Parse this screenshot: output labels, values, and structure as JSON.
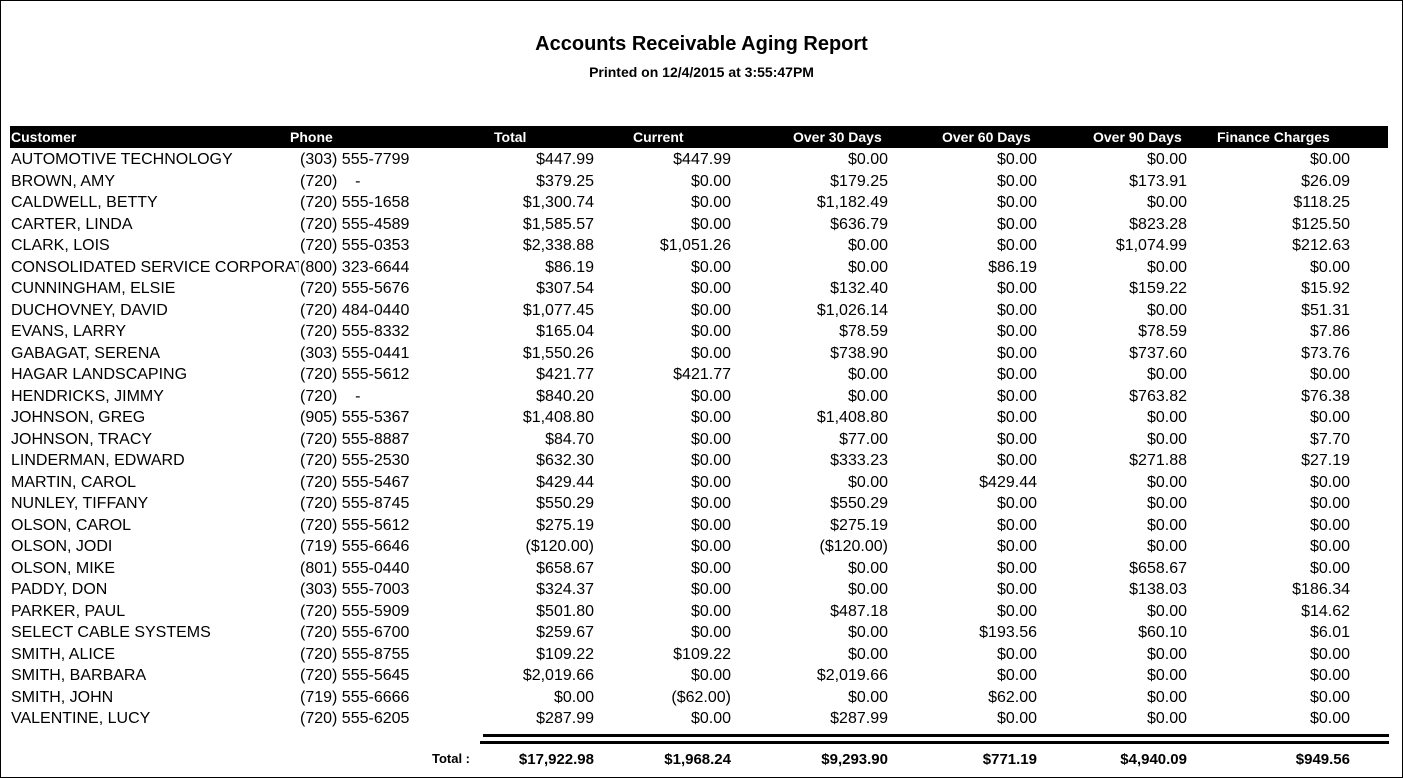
{
  "report": {
    "title": "Accounts Receivable Aging Report",
    "printed": "Printed on 12/4/2015 at  3:55:47PM"
  },
  "columns": {
    "customer": "Customer",
    "phone": "Phone",
    "total": "Total",
    "current": "Current",
    "over30": "Over 30 Days",
    "over60": "Over 60 Days",
    "over90": "Over 90 Days",
    "finance": "Finance Charges"
  },
  "rows": [
    {
      "customer": "AUTOMOTIVE TECHNOLOGY",
      "phone": "(303) 555-7799",
      "total": "$447.99",
      "current": "$447.99",
      "over30": "$0.00",
      "over60": "$0.00",
      "over90": "$0.00",
      "finance": "$0.00"
    },
    {
      "customer": "BROWN, AMY",
      "phone": "(720)    -",
      "total": "$379.25",
      "current": "$0.00",
      "over30": "$179.25",
      "over60": "$0.00",
      "over90": "$173.91",
      "finance": "$26.09"
    },
    {
      "customer": "CALDWELL, BETTY",
      "phone": "(720) 555-1658",
      "total": "$1,300.74",
      "current": "$0.00",
      "over30": "$1,182.49",
      "over60": "$0.00",
      "over90": "$0.00",
      "finance": "$118.25"
    },
    {
      "customer": "CARTER, LINDA",
      "phone": "(720) 555-4589",
      "total": "$1,585.57",
      "current": "$0.00",
      "over30": "$636.79",
      "over60": "$0.00",
      "over90": "$823.28",
      "finance": "$125.50"
    },
    {
      "customer": "CLARK, LOIS",
      "phone": "(720) 555-0353",
      "total": "$2,338.88",
      "current": "$1,051.26",
      "over30": "$0.00",
      "over60": "$0.00",
      "over90": "$1,074.99",
      "finance": "$212.63"
    },
    {
      "customer": "CONSOLIDATED SERVICE CORPORATION",
      "phone": "(800) 323-6644",
      "total": "$86.19",
      "current": "$0.00",
      "over30": "$0.00",
      "over60": "$86.19",
      "over90": "$0.00",
      "finance": "$0.00"
    },
    {
      "customer": "CUNNINGHAM, ELSIE",
      "phone": "(720) 555-5676",
      "total": "$307.54",
      "current": "$0.00",
      "over30": "$132.40",
      "over60": "$0.00",
      "over90": "$159.22",
      "finance": "$15.92"
    },
    {
      "customer": "DUCHOVNEY, DAVID",
      "phone": "(720) 484-0440",
      "total": "$1,077.45",
      "current": "$0.00",
      "over30": "$1,026.14",
      "over60": "$0.00",
      "over90": "$0.00",
      "finance": "$51.31"
    },
    {
      "customer": "EVANS, LARRY",
      "phone": "(720) 555-8332",
      "total": "$165.04",
      "current": "$0.00",
      "over30": "$78.59",
      "over60": "$0.00",
      "over90": "$78.59",
      "finance": "$7.86"
    },
    {
      "customer": "GABAGAT, SERENA",
      "phone": "(303) 555-0441",
      "total": "$1,550.26",
      "current": "$0.00",
      "over30": "$738.90",
      "over60": "$0.00",
      "over90": "$737.60",
      "finance": "$73.76"
    },
    {
      "customer": "HAGAR LANDSCAPING",
      "phone": "(720) 555-5612",
      "total": "$421.77",
      "current": "$421.77",
      "over30": "$0.00",
      "over60": "$0.00",
      "over90": "$0.00",
      "finance": "$0.00"
    },
    {
      "customer": "HENDRICKS, JIMMY",
      "phone": "(720)    -",
      "total": "$840.20",
      "current": "$0.00",
      "over30": "$0.00",
      "over60": "$0.00",
      "over90": "$763.82",
      "finance": "$76.38"
    },
    {
      "customer": "JOHNSON, GREG",
      "phone": "(905) 555-5367",
      "total": "$1,408.80",
      "current": "$0.00",
      "over30": "$1,408.80",
      "over60": "$0.00",
      "over90": "$0.00",
      "finance": "$0.00"
    },
    {
      "customer": "JOHNSON, TRACY",
      "phone": "(720) 555-8887",
      "total": "$84.70",
      "current": "$0.00",
      "over30": "$77.00",
      "over60": "$0.00",
      "over90": "$0.00",
      "finance": "$7.70"
    },
    {
      "customer": "LINDERMAN, EDWARD",
      "phone": "(720) 555-2530",
      "total": "$632.30",
      "current": "$0.00",
      "over30": "$333.23",
      "over60": "$0.00",
      "over90": "$271.88",
      "finance": "$27.19"
    },
    {
      "customer": "MARTIN, CAROL",
      "phone": "(720) 555-5467",
      "total": "$429.44",
      "current": "$0.00",
      "over30": "$0.00",
      "over60": "$429.44",
      "over90": "$0.00",
      "finance": "$0.00"
    },
    {
      "customer": "NUNLEY, TIFFANY",
      "phone": "(720) 555-8745",
      "total": "$550.29",
      "current": "$0.00",
      "over30": "$550.29",
      "over60": "$0.00",
      "over90": "$0.00",
      "finance": "$0.00"
    },
    {
      "customer": "OLSON, CAROL",
      "phone": "(720) 555-5612",
      "total": "$275.19",
      "current": "$0.00",
      "over30": "$275.19",
      "over60": "$0.00",
      "over90": "$0.00",
      "finance": "$0.00"
    },
    {
      "customer": "OLSON, JODI",
      "phone": "(719) 555-6646",
      "total": "($120.00)",
      "current": "$0.00",
      "over30": "($120.00)",
      "over60": "$0.00",
      "over90": "$0.00",
      "finance": "$0.00"
    },
    {
      "customer": "OLSON, MIKE",
      "phone": "(801) 555-0440",
      "total": "$658.67",
      "current": "$0.00",
      "over30": "$0.00",
      "over60": "$0.00",
      "over90": "$658.67",
      "finance": "$0.00"
    },
    {
      "customer": "PADDY, DON",
      "phone": "(303) 555-7003",
      "total": "$324.37",
      "current": "$0.00",
      "over30": "$0.00",
      "over60": "$0.00",
      "over90": "$138.03",
      "finance": "$186.34"
    },
    {
      "customer": "PARKER, PAUL",
      "phone": "(720) 555-5909",
      "total": "$501.80",
      "current": "$0.00",
      "over30": "$487.18",
      "over60": "$0.00",
      "over90": "$0.00",
      "finance": "$14.62"
    },
    {
      "customer": "SELECT CABLE SYSTEMS",
      "phone": "(720) 555-6700",
      "total": "$259.67",
      "current": "$0.00",
      "over30": "$0.00",
      "over60": "$193.56",
      "over90": "$60.10",
      "finance": "$6.01"
    },
    {
      "customer": "SMITH, ALICE",
      "phone": "(720) 555-8755",
      "total": "$109.22",
      "current": "$109.22",
      "over30": "$0.00",
      "over60": "$0.00",
      "over90": "$0.00",
      "finance": "$0.00"
    },
    {
      "customer": "SMITH, BARBARA",
      "phone": "(720) 555-5645",
      "total": "$2,019.66",
      "current": "$0.00",
      "over30": "$2,019.66",
      "over60": "$0.00",
      "over90": "$0.00",
      "finance": "$0.00"
    },
    {
      "customer": "SMITH, JOHN",
      "phone": "(719) 555-6666",
      "total": "$0.00",
      "current": "($62.00)",
      "over30": "$0.00",
      "over60": "$62.00",
      "over90": "$0.00",
      "finance": "$0.00"
    },
    {
      "customer": "VALENTINE, LUCY",
      "phone": "(720) 555-6205",
      "total": "$287.99",
      "current": "$0.00",
      "over30": "$287.99",
      "over60": "$0.00",
      "over90": "$0.00",
      "finance": "$0.00"
    }
  ],
  "totals": {
    "label": "Total :",
    "total": "$17,922.98",
    "current": "$1,968.24",
    "over30": "$9,293.90",
    "over60": "$771.19",
    "over90": "$4,940.09",
    "finance": "$949.56"
  }
}
